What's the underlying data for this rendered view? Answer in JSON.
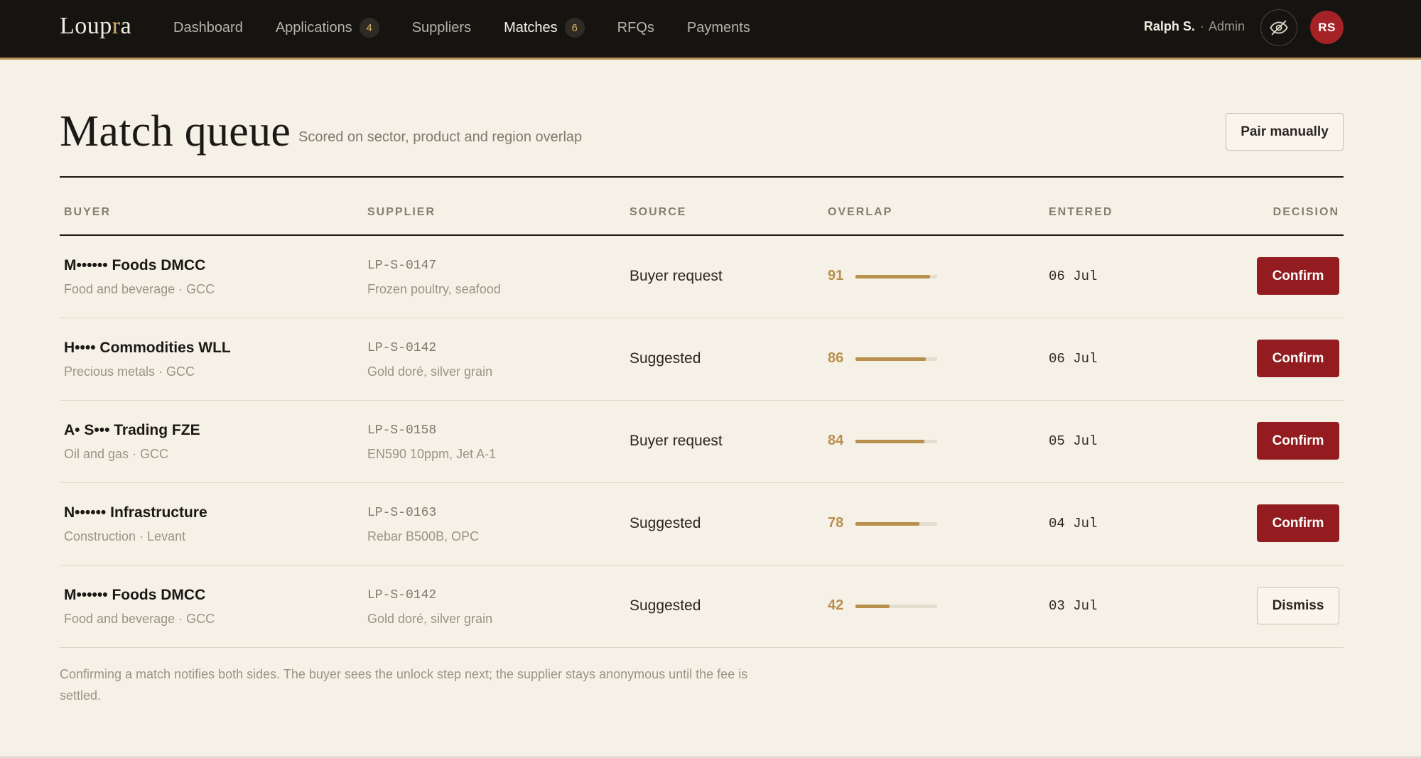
{
  "app": {
    "logo_main": "Loup",
    "logo_accent": "r",
    "logo_end": "a"
  },
  "nav": [
    {
      "label": "Dashboard",
      "badge": null,
      "active": false
    },
    {
      "label": "Applications",
      "badge": "4",
      "active": false
    },
    {
      "label": "Suppliers",
      "badge": null,
      "active": false
    },
    {
      "label": "Matches",
      "badge": "6",
      "active": true
    },
    {
      "label": "RFQs",
      "badge": null,
      "active": false
    },
    {
      "label": "Payments",
      "badge": null,
      "active": false
    }
  ],
  "user": {
    "name": "Ralph S.",
    "separator": "·",
    "role": "Admin",
    "initials": "RS",
    "privacy_icon": "eye-off-icon"
  },
  "header": {
    "title": "Match queue",
    "subtitle": "Scored on sector, product and region overlap",
    "pair_button": "Pair manually"
  },
  "table": {
    "columns": [
      "BUYER",
      "SUPPLIER",
      "SOURCE",
      "OVERLAP",
      "ENTERED",
      "DECISION"
    ],
    "rows": [
      {
        "buyer": "M•••••• Foods DMCC",
        "buyer_sub": "Food and beverage · GCC",
        "supplier_id": "LP-S-0147",
        "supplier_sub": "Frozen poultry, seafood",
        "source": "Buyer request",
        "overlap": 91,
        "entered": "06 Jul",
        "decision": "Confirm",
        "decision_type": "confirm"
      },
      {
        "buyer": "H•••• Commodities WLL",
        "buyer_sub": "Precious metals · GCC",
        "supplier_id": "LP-S-0142",
        "supplier_sub": "Gold doré, silver grain",
        "source": "Suggested",
        "overlap": 86,
        "entered": "06 Jul",
        "decision": "Confirm",
        "decision_type": "confirm"
      },
      {
        "buyer": "A• S••• Trading FZE",
        "buyer_sub": "Oil and gas · GCC",
        "supplier_id": "LP-S-0158",
        "supplier_sub": "EN590 10ppm, Jet A-1",
        "source": "Buyer request",
        "overlap": 84,
        "entered": "05 Jul",
        "decision": "Confirm",
        "decision_type": "confirm"
      },
      {
        "buyer": "N•••••• Infrastructure",
        "buyer_sub": "Construction · Levant",
        "supplier_id": "LP-S-0163",
        "supplier_sub": "Rebar B500B, OPC",
        "source": "Suggested",
        "overlap": 78,
        "entered": "04 Jul",
        "decision": "Confirm",
        "decision_type": "confirm"
      },
      {
        "buyer": "M•••••• Foods DMCC",
        "buyer_sub": "Food and beverage · GCC",
        "supplier_id": "LP-S-0142",
        "supplier_sub": "Gold doré, silver grain",
        "source": "Suggested",
        "overlap": 42,
        "entered": "03 Jul",
        "decision": "Dismiss",
        "decision_type": "dismiss"
      }
    ]
  },
  "footnote": "Confirming a match notifies both sides. The buyer sees the unlock step next; the supplier stays anonymous until the fee is settled.",
  "colors": {
    "topbar": "#151411",
    "accent_gold": "#b98f4e",
    "confirm_red": "#921c1f",
    "background": "#f6f1e7"
  }
}
